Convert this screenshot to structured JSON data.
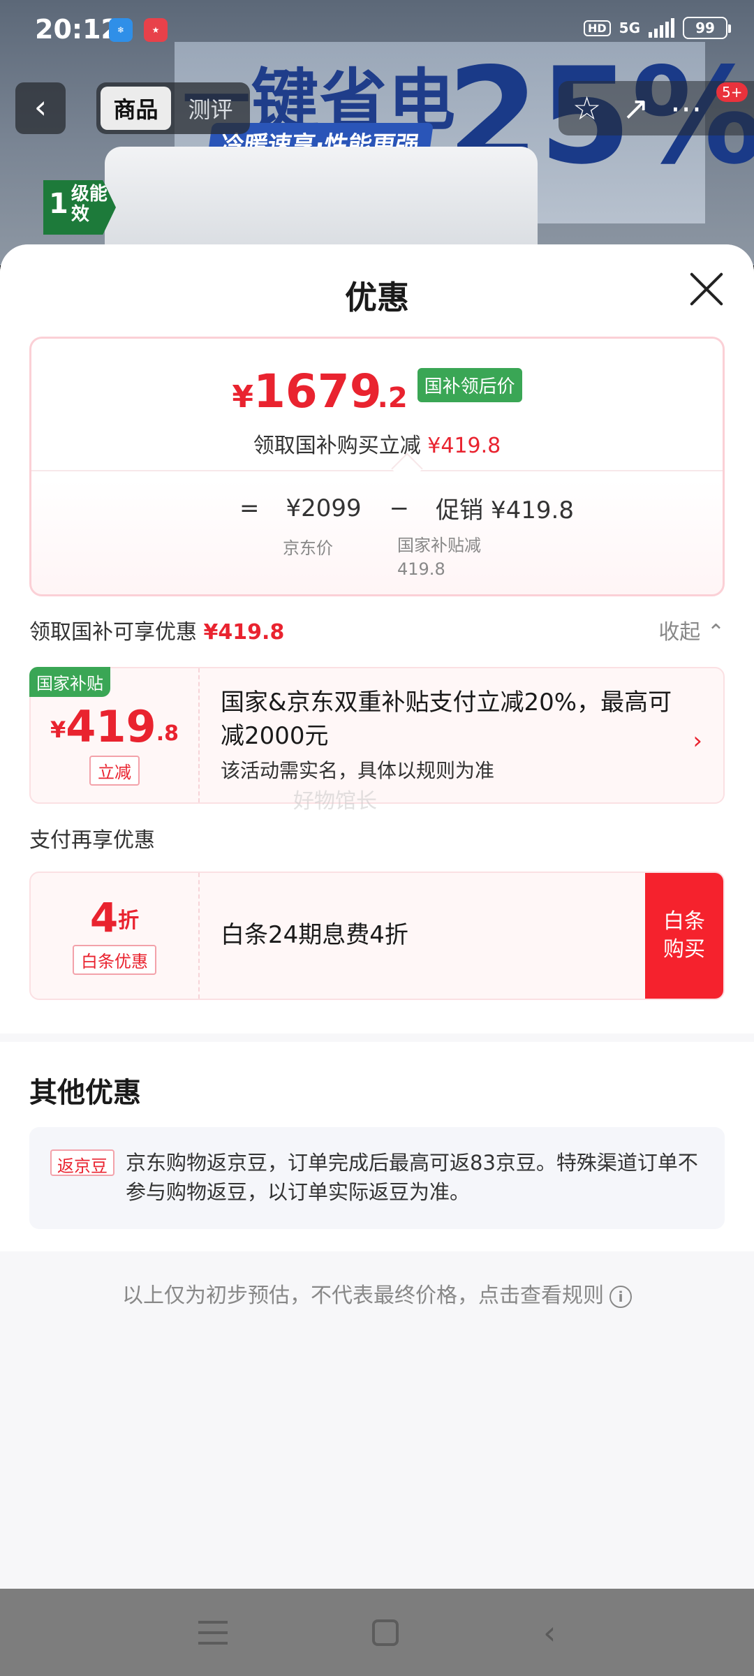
{
  "status_bar": {
    "time": "20:12",
    "hd": "HD",
    "network": "5G",
    "battery": "99"
  },
  "background": {
    "banner_headline": "一键省电",
    "banner_percent": "25%",
    "banner_slogan": "冷暖速享·性能更强",
    "energy_level": "1",
    "energy_label": "级能效",
    "tabs": [
      "商品",
      "测评"
    ],
    "badge": "5+"
  },
  "sheet": {
    "title": "优惠",
    "price_card": {
      "currency": "¥",
      "final_int": "1679",
      "final_dec": ".2",
      "tag": "国补领后价",
      "sub_prefix": "领取国补购买立减",
      "sub_amount": "¥419.8",
      "eq": "=",
      "jd_price": "¥2099",
      "minus": "−",
      "promo": "促销 ¥419.8",
      "jd_price_label": "京东价",
      "subsidy_label": "国家补贴减",
      "subsidy_value": "419.8"
    },
    "section1": {
      "label": "领取国补可享优惠",
      "amount": "¥419.8",
      "collapse": "收起"
    },
    "coupon_national": {
      "flag": "国家补贴",
      "yen": "¥",
      "amount_int": "419",
      "amount_dec": ".8",
      "tag": "立减",
      "title": "国家&京东双重补贴支付立减20%，最高可减2000元",
      "desc": "该活动需实名，具体以规则为准"
    },
    "watermark": "好物馆长",
    "pay_section_title": "支付再享优惠",
    "coupon_baitiao": {
      "discount_num": "4",
      "discount_unit": "折",
      "tag": "白条优惠",
      "title": "白条24期息费4折",
      "button": "白条购买"
    },
    "other": {
      "title": "其他优惠",
      "tag": "返京豆",
      "text": "京东购物返京豆，订单完成后最高可返83京豆。特殊渠道订单不参与购物返豆，以订单实际返豆为准。"
    },
    "disclaimer": "以上仅为初步预估，不代表最终价格，点击查看规则"
  },
  "icons": {
    "back": "chevron-left-icon",
    "close": "close-icon",
    "star": "star-icon",
    "share": "share-icon",
    "more": "more-icon",
    "info": "info-icon"
  },
  "colors": {
    "accent_red": "#e9232f",
    "subsidy_green": "#3aa655",
    "baitiao_button": "#f5222d"
  }
}
